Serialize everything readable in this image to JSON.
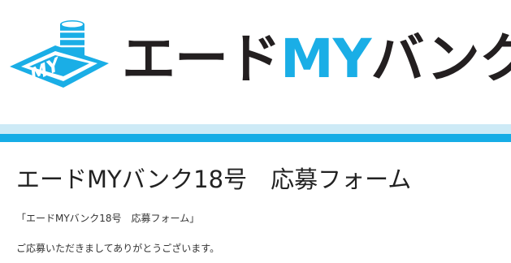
{
  "header": {
    "logo_mark_text": "MY",
    "logo_text_part1": "エード",
    "logo_text_part2": "MY",
    "logo_text_part3": "バンク",
    "colors": {
      "logo_dark": "#231f20",
      "logo_blue": "#1aaee6",
      "band_light": "#cdeaf6",
      "band_blue": "#16ade6"
    },
    "logo_icon": "coin-stack-icon"
  },
  "main": {
    "title": "エードMYバンク18号　応募フォーム",
    "form_label": "「エードMYバンク18号　応募フォーム」",
    "thanks": "ご応募いただきましてありがとうございます。"
  }
}
